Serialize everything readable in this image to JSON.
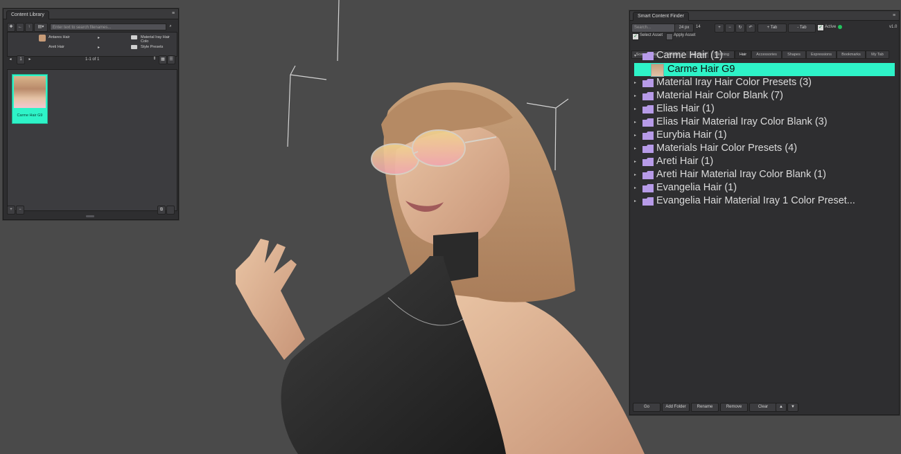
{
  "content_library": {
    "tab_title": "Content Library",
    "search_placeholder": "Enter text to search filenames...",
    "tree_items": [
      "Antares Hair",
      "Areti Hair",
      "Material Iray Hair Colo",
      "Style Presets"
    ],
    "pager": "1-1 of 1",
    "page_number": "1",
    "thumbnail_label": "Carme Hair G9"
  },
  "smart_content_finder": {
    "tab_title": "Smart Content Finder",
    "search_placeholder": "Search...",
    "size_value": "24 px",
    "count_value": "14",
    "plus_tab_label": "+ Tab",
    "minus_tab_label": "- Tab",
    "active_label": "Active",
    "version": "v1.0",
    "select_asset_label": "Select Asset",
    "apply_asset_label": "Apply Asset",
    "tabs": [
      "Scene Items",
      "Poses",
      "Materials",
      "Clothing",
      "Hair",
      "Accessories",
      "Shapes",
      "Expressions",
      "Bookmarks",
      "My Tab"
    ],
    "tree": [
      {
        "label": "Carme Hair (1)",
        "expanded": true
      },
      {
        "label": "Material Iray Hair Color Presets (3)"
      },
      {
        "label": "Material Hair Color Blank (7)"
      },
      {
        "label": "Elias Hair (1)"
      },
      {
        "label": "Elias Hair Material Iray Color Blank (3)"
      },
      {
        "label": "Eurybia Hair (1)"
      },
      {
        "label": "Materials Hair Color Presets (4)"
      },
      {
        "label": "Areti Hair (1)"
      },
      {
        "label": "Areti Hair Material Iray Color Blank (1)"
      },
      {
        "label": "Evangelia Hair (1)"
      },
      {
        "label": "Evangelia Hair Material Iray 1 Color Preset..."
      }
    ],
    "selected_item": "Carme Hair G9",
    "bottom_buttons": [
      "Go",
      "Add Folder",
      "Rename",
      "Remove",
      "Clear"
    ],
    "arrow_up": "▲",
    "arrow_down": "▼"
  },
  "colors": {
    "highlight": "#2ef3c8",
    "folder": "#b79be8",
    "active_dot": "#22c55e"
  }
}
